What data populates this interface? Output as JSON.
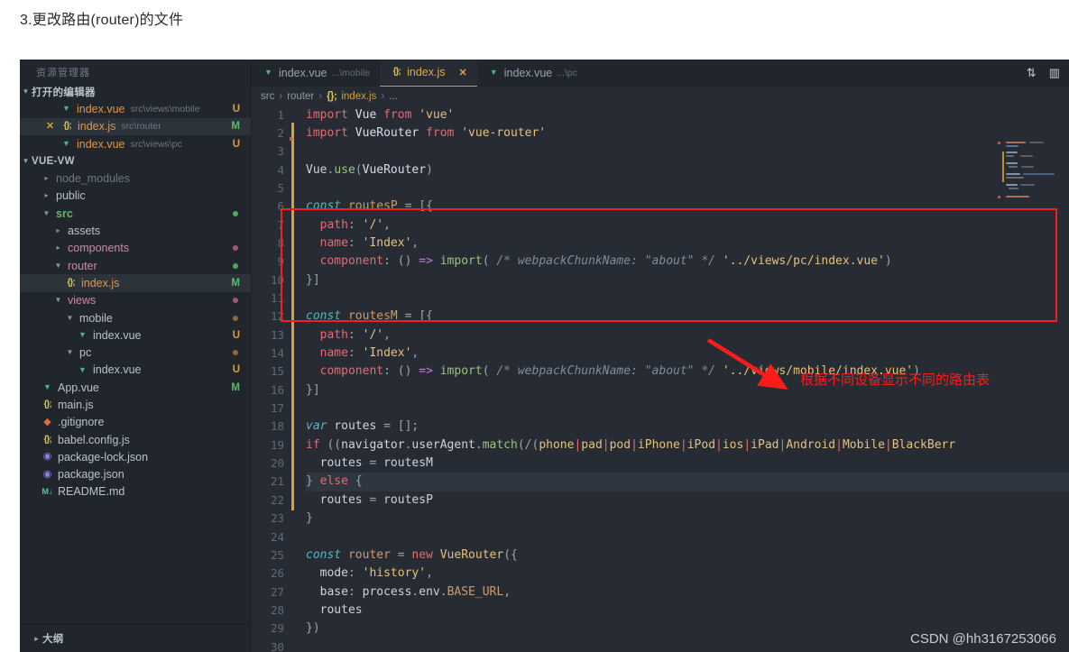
{
  "heading": "3.更改路由(router)的文件",
  "sidebar": {
    "title": "资源管理器",
    "open_editors_section": "打开的编辑器",
    "project_section": "VUE-VW",
    "outline_section": "大纲",
    "open_editors": [
      {
        "icon": "vue-icon",
        "name": "index.vue",
        "path": "src\\views\\mobile",
        "badge": "U"
      },
      {
        "icon": "js-icon",
        "name": "index.js",
        "path": "src\\router",
        "badge": "M",
        "closable": true,
        "selected": true
      },
      {
        "icon": "vue-icon",
        "name": "index.vue",
        "path": "src\\views\\pc",
        "badge": "U"
      }
    ],
    "tree": [
      {
        "label": "node_modules",
        "kind": "folder",
        "expanded": false,
        "indent": 1,
        "muted": true
      },
      {
        "label": "public",
        "kind": "folder",
        "expanded": false,
        "indent": 1
      },
      {
        "label": "src",
        "kind": "folder",
        "expanded": true,
        "indent": 1,
        "dot": "green",
        "active": true
      },
      {
        "label": "assets",
        "kind": "folder",
        "expanded": false,
        "indent": 2
      },
      {
        "label": "components",
        "kind": "folder",
        "expanded": false,
        "indent": 2,
        "dot": "pink"
      },
      {
        "label": "router",
        "kind": "folder",
        "expanded": true,
        "indent": 2,
        "dot": "green"
      },
      {
        "label": "index.js",
        "kind": "js",
        "indent": 3,
        "badge": "M",
        "selected": true
      },
      {
        "label": "views",
        "kind": "folder",
        "expanded": true,
        "indent": 2,
        "dot": "pink"
      },
      {
        "label": "mobile",
        "kind": "folder",
        "expanded": true,
        "indent": 3,
        "dot": "orange"
      },
      {
        "label": "index.vue",
        "kind": "vue",
        "indent": 4,
        "badge": "U"
      },
      {
        "label": "pc",
        "kind": "folder",
        "expanded": true,
        "indent": 3,
        "dot": "orange"
      },
      {
        "label": "index.vue",
        "kind": "vue",
        "indent": 4,
        "badge": "U"
      },
      {
        "label": "App.vue",
        "kind": "vue",
        "indent": 1,
        "badge": "M"
      },
      {
        "label": "main.js",
        "kind": "js",
        "indent": 1
      },
      {
        "label": ".gitignore",
        "kind": "git",
        "indent": 1
      },
      {
        "label": "babel.config.js",
        "kind": "js",
        "indent": 1
      },
      {
        "label": "package-lock.json",
        "kind": "json",
        "indent": 1
      },
      {
        "label": "package.json",
        "kind": "json",
        "indent": 1
      },
      {
        "label": "README.md",
        "kind": "md",
        "indent": 1
      }
    ]
  },
  "editor": {
    "tabs": [
      {
        "icon": "vue-icon",
        "label": "index.vue",
        "path": "...\\mobile",
        "active": false
      },
      {
        "icon": "js-icon",
        "label": "index.js",
        "path": "",
        "active": true,
        "close": "✕"
      },
      {
        "icon": "vue-icon",
        "label": "index.vue",
        "path": "...\\pc",
        "active": false
      }
    ],
    "actions": [
      {
        "name": "split-editor-icon",
        "glyph": "⇅"
      },
      {
        "name": "toggle-layout-icon",
        "glyph": "▥"
      }
    ],
    "breadcrumb": [
      "src",
      "router",
      "index.js",
      "..."
    ],
    "code_lines": [
      {
        "n": 1,
        "tokens": [
          [
            "k-import",
            "import "
          ],
          [
            "k-id",
            "Vue "
          ],
          [
            "k-import",
            "from "
          ],
          [
            "k-str",
            "'vue'"
          ]
        ]
      },
      {
        "n": 2,
        "tokens": [
          [
            "k-import",
            "import "
          ],
          [
            "k-id",
            "VueRouter "
          ],
          [
            "k-import",
            "from "
          ],
          [
            "k-str",
            "'vue-router'"
          ]
        ]
      },
      {
        "n": 3,
        "tokens": []
      },
      {
        "n": 4,
        "tokens": [
          [
            "k-white",
            "Vue"
          ],
          [
            "k-punct",
            "."
          ],
          [
            "k-meth",
            "use"
          ],
          [
            "k-punct",
            "("
          ],
          [
            "k-id",
            "VueRouter"
          ],
          [
            "k-punct",
            ")"
          ]
        ]
      },
      {
        "n": 5,
        "tokens": []
      },
      {
        "n": 6,
        "tokens": [
          [
            "k-kw-i",
            "const "
          ],
          [
            "k-var",
            "routesP "
          ],
          [
            "k-punct",
            "= "
          ],
          [
            "k-punct",
            "[{"
          ]
        ]
      },
      {
        "n": 7,
        "tokens": [
          [
            "k-white",
            "  "
          ],
          [
            "k-prop",
            "path"
          ],
          [
            "k-punct",
            ": "
          ],
          [
            "k-str",
            "'/'"
          ],
          [
            "k-punct",
            ","
          ]
        ]
      },
      {
        "n": 8,
        "tokens": [
          [
            "k-white",
            "  "
          ],
          [
            "k-prop",
            "name"
          ],
          [
            "k-punct",
            ": "
          ],
          [
            "k-str",
            "'Index'"
          ],
          [
            "k-punct",
            ","
          ]
        ]
      },
      {
        "n": 9,
        "tokens": [
          [
            "k-white",
            "  "
          ],
          [
            "k-prop",
            "component"
          ],
          [
            "k-punct",
            ": () "
          ],
          [
            "k-arrow",
            "=> "
          ],
          [
            "k-meth",
            "import"
          ],
          [
            "k-punct",
            "( "
          ],
          [
            "k-comment",
            "/* webpackChunkName: \"about\" */ "
          ],
          [
            "k-str",
            "'../views/pc/index.vue'"
          ],
          [
            "k-punct",
            ")"
          ]
        ]
      },
      {
        "n": 10,
        "tokens": [
          [
            "k-punct",
            "}]"
          ]
        ]
      },
      {
        "n": 11,
        "tokens": []
      },
      {
        "n": 12,
        "tokens": [
          [
            "k-kw-i",
            "const "
          ],
          [
            "k-var",
            "routesM "
          ],
          [
            "k-punct",
            "= "
          ],
          [
            "k-punct",
            "[{"
          ]
        ]
      },
      {
        "n": 13,
        "tokens": [
          [
            "k-white",
            "  "
          ],
          [
            "k-prop",
            "path"
          ],
          [
            "k-punct",
            ": "
          ],
          [
            "k-str",
            "'/'"
          ],
          [
            "k-punct",
            ","
          ]
        ]
      },
      {
        "n": 14,
        "tokens": [
          [
            "k-white",
            "  "
          ],
          [
            "k-prop",
            "name"
          ],
          [
            "k-punct",
            ": "
          ],
          [
            "k-str",
            "'Index'"
          ],
          [
            "k-punct",
            ","
          ]
        ]
      },
      {
        "n": 15,
        "tokens": [
          [
            "k-white",
            "  "
          ],
          [
            "k-prop",
            "component"
          ],
          [
            "k-punct",
            ": () "
          ],
          [
            "k-arrow",
            "=> "
          ],
          [
            "k-meth",
            "import"
          ],
          [
            "k-punct",
            "( "
          ],
          [
            "k-comment",
            "/* webpackChunkName: \"about\" */ "
          ],
          [
            "k-str",
            "'../views/mobile/index.vue'"
          ],
          [
            "k-punct",
            ")"
          ]
        ]
      },
      {
        "n": 16,
        "tokens": [
          [
            "k-punct",
            "}]"
          ]
        ]
      },
      {
        "n": 17,
        "tokens": []
      },
      {
        "n": 18,
        "tokens": [
          [
            "k-kw-i",
            "var "
          ],
          [
            "k-white",
            "routes "
          ],
          [
            "k-punct",
            "= "
          ],
          [
            "k-punct",
            "[];"
          ]
        ]
      },
      {
        "n": 19,
        "tokens": [
          [
            "k-ctrl",
            "if "
          ],
          [
            "k-punct",
            "(("
          ],
          [
            "k-white",
            "navigator"
          ],
          [
            "k-punct",
            "."
          ],
          [
            "k-white",
            "userAgent"
          ],
          [
            "k-punct",
            "."
          ],
          [
            "k-meth",
            "match"
          ],
          [
            "k-punct",
            "(/("
          ],
          [
            "k-regex",
            "phone"
          ],
          [
            "k-pipe",
            "|"
          ],
          [
            "k-regex",
            "pad"
          ],
          [
            "k-pipe",
            "|"
          ],
          [
            "k-regex",
            "pod"
          ],
          [
            "k-pipe",
            "|"
          ],
          [
            "k-regex",
            "iPhone"
          ],
          [
            "k-pipe",
            "|"
          ],
          [
            "k-regex",
            "iPod"
          ],
          [
            "k-pipe",
            "|"
          ],
          [
            "k-regex",
            "ios"
          ],
          [
            "k-pipe",
            "|"
          ],
          [
            "k-regex",
            "iPad"
          ],
          [
            "k-pipe",
            "|"
          ],
          [
            "k-regex",
            "Android"
          ],
          [
            "k-pipe",
            "|"
          ],
          [
            "k-regex",
            "Mobile"
          ],
          [
            "k-pipe",
            "|"
          ],
          [
            "k-regex",
            "BlackBerr"
          ]
        ]
      },
      {
        "n": 20,
        "tokens": [
          [
            "k-white",
            "  routes "
          ],
          [
            "k-punct",
            "= "
          ],
          [
            "k-white",
            "routesM"
          ]
        ]
      },
      {
        "n": 21,
        "tokens": [
          [
            "k-punct",
            "} "
          ],
          [
            "k-ctrl",
            "else "
          ],
          [
            "k-punct",
            "{"
          ]
        ],
        "cursorline": true
      },
      {
        "n": 22,
        "tokens": [
          [
            "k-white",
            "  routes "
          ],
          [
            "k-punct",
            "= "
          ],
          [
            "k-white",
            "routesP"
          ]
        ]
      },
      {
        "n": 23,
        "tokens": [
          [
            "k-punct",
            "}"
          ]
        ]
      },
      {
        "n": 24,
        "tokens": []
      },
      {
        "n": 25,
        "tokens": [
          [
            "k-kw-i",
            "const "
          ],
          [
            "k-var",
            "router "
          ],
          [
            "k-punct",
            "= "
          ],
          [
            "k-ctrl",
            "new "
          ],
          [
            "k-cls",
            "VueRouter"
          ],
          [
            "k-punct",
            "({"
          ]
        ]
      },
      {
        "n": 26,
        "tokens": [
          [
            "k-white",
            "  "
          ],
          [
            "k-white",
            "mode"
          ],
          [
            "k-punct",
            ": "
          ],
          [
            "k-str",
            "'history'"
          ],
          [
            "k-punct",
            ","
          ]
        ]
      },
      {
        "n": 27,
        "tokens": [
          [
            "k-white",
            "  base"
          ],
          [
            "k-punct",
            ": "
          ],
          [
            "k-white",
            "process"
          ],
          [
            "k-punct",
            "."
          ],
          [
            "k-white",
            "env"
          ],
          [
            "k-punct",
            "."
          ],
          [
            "k-var",
            "BASE_URL"
          ],
          [
            "k-punct",
            ","
          ]
        ]
      },
      {
        "n": 28,
        "tokens": [
          [
            "k-white",
            "  routes"
          ]
        ]
      },
      {
        "n": 29,
        "tokens": [
          [
            "k-punct",
            "})"
          ]
        ]
      },
      {
        "n": 30,
        "tokens": []
      }
    ],
    "annotation": {
      "note": "根据不同设备显示不同的路由表",
      "box_color": "#fd1c1c"
    }
  },
  "watermark": "CSDN @hh3167253066"
}
